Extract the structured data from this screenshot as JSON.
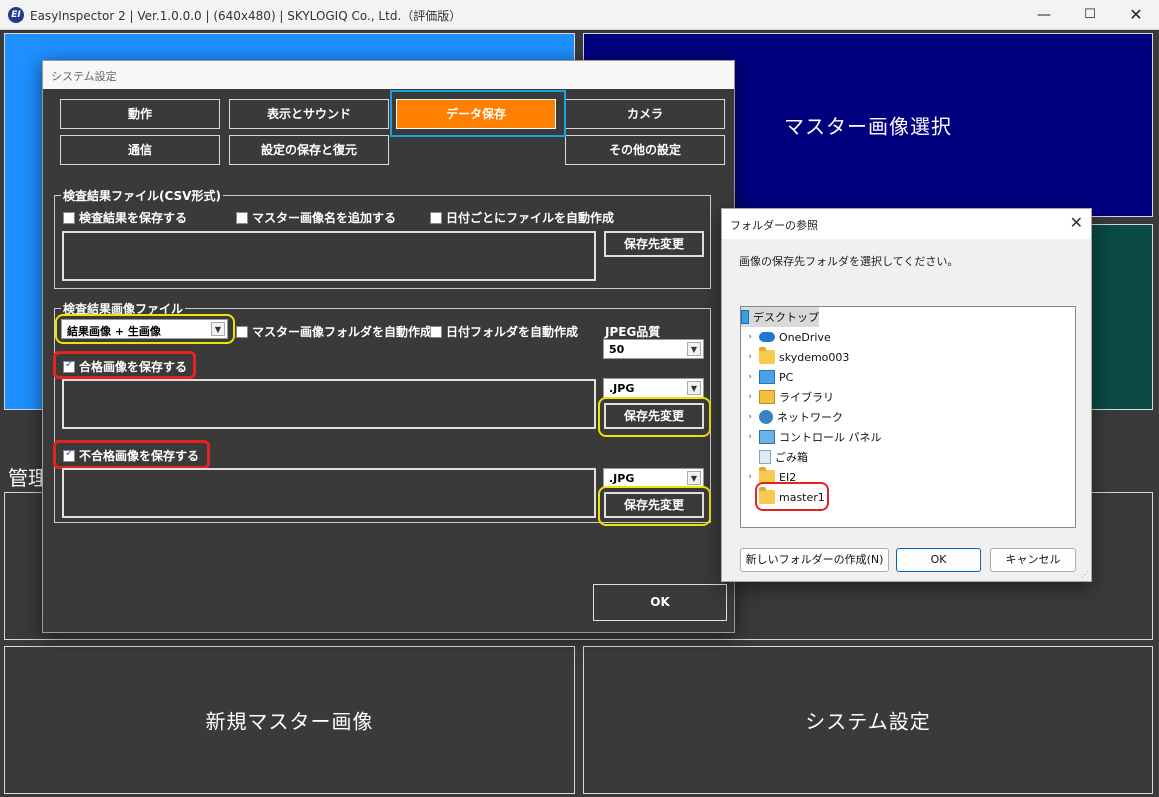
{
  "window": {
    "title": "EasyInspector 2 | Ver.1.0.0.0 | (640x480) | SKYLOGIQ Co., Ltd.（評価版）",
    "logo_letter": "EI",
    "controls": {
      "minimize": "—",
      "maximize": "☐",
      "close": "✕"
    }
  },
  "main": {
    "tile_master_select": "マスター画像選択",
    "section_label": "管理",
    "tile_new_master": "新規マスター画像",
    "tile_system_settings": "システム設定"
  },
  "system_dialog": {
    "title": "システム設定",
    "tabs": [
      {
        "label": "動作"
      },
      {
        "label": "表示とサウンド"
      },
      {
        "label": "データ保存"
      },
      {
        "label": "カメラ"
      },
      {
        "label": "通信"
      },
      {
        "label": "設定の保存と復元"
      },
      {
        "label": "その他の設定"
      }
    ],
    "csv_group": {
      "title": "検査結果ファイル(CSV形式)",
      "save_result": "検査結果を保存する",
      "add_master_name": "マスター画像名を追加する",
      "daily_file": "日付ごとにファイルを自動作成",
      "path_value": "",
      "change_button": "保存先変更"
    },
    "image_group": {
      "title": "検査結果画像ファイル",
      "image_type": "結果画像 + 生画像",
      "auto_master_folder": "マスター画像フォルダを自動作成",
      "auto_date_folder": "日付フォルダを自動作成",
      "jpeg_quality_label": "JPEG品質",
      "jpeg_quality": "50",
      "save_pass": "合格画像を保存する",
      "pass_path": "",
      "pass_format": ".JPG",
      "pass_change_button": "保存先変更",
      "save_fail": "不合格画像を保存する",
      "fail_path": "",
      "fail_format": ".JPG",
      "fail_change_button": "保存先変更"
    },
    "ok_button": "OK"
  },
  "folder_dialog": {
    "title": "フォルダーの参照",
    "close": "✕",
    "message": "画像の保存先フォルダを選択してください。",
    "tree": [
      {
        "label": "デスクトップ",
        "icon": "desktop-icon",
        "chevron": ""
      },
      {
        "label": "OneDrive",
        "icon": "cloud-icon",
        "chevron": "›"
      },
      {
        "label": "skydemo003",
        "icon": "folder-icon",
        "chevron": "›"
      },
      {
        "label": "PC",
        "icon": "pc-icon",
        "chevron": "›"
      },
      {
        "label": "ライブラリ",
        "icon": "library-icon",
        "chevron": "›"
      },
      {
        "label": "ネットワーク",
        "icon": "network-icon",
        "chevron": "›"
      },
      {
        "label": "コントロール パネル",
        "icon": "control-panel-icon",
        "chevron": "›"
      },
      {
        "label": "ごみ箱",
        "icon": "recycle-bin-icon",
        "chevron": ""
      },
      {
        "label": "EI2",
        "icon": "folder-icon",
        "chevron": "›"
      },
      {
        "label": "master1",
        "icon": "folder-icon",
        "chevron": ""
      }
    ],
    "new_folder_button": "新しいフォルダーの作成(N)",
    "ok_button": "OK",
    "cancel_button": "キャンセル"
  },
  "colors": {
    "active_tab": "#ff7f00",
    "master_tile": "#00007f",
    "left_tile": "#1e90ff",
    "teal_tile": "#0b4a45",
    "highlight_red": "#e52222",
    "highlight_yellow": "#f2e200",
    "highlight_blue": "#1ba1e2"
  }
}
